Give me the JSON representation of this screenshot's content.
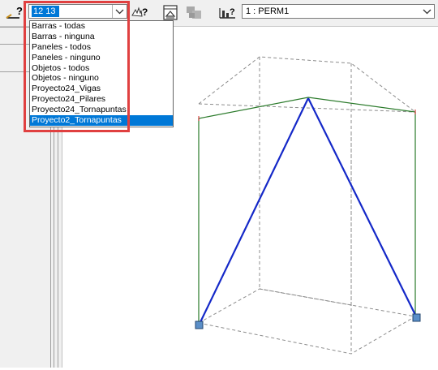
{
  "toolbar": {
    "filter_select": {
      "value": "12 13",
      "options": [
        "Barras - todas",
        "Barras - ninguna",
        "Paneles - todos",
        "Paneles - ninguno",
        "Objetos - todos",
        "Objetos - ninguno",
        "Proyecto24_Vigas",
        "Proyecto24_Pilares",
        "Proyecto24_Tornapuntas",
        "Proyecto2_Tornapuntas"
      ],
      "highlighted_option": "Proyecto2_Tornapuntas"
    },
    "load_case_select": {
      "value": "1 : PERM1"
    },
    "icons": [
      "query-icon",
      "hand-query-icon",
      "print-preview-icon",
      "grayed-tool-icon",
      "chart-icon"
    ]
  },
  "colors": {
    "highlight_border": "#e04040",
    "selection_bg": "#0078d7",
    "brace": "#1428c8",
    "frame": "#2a7a2a",
    "box_lines": "#8c8c8c"
  }
}
